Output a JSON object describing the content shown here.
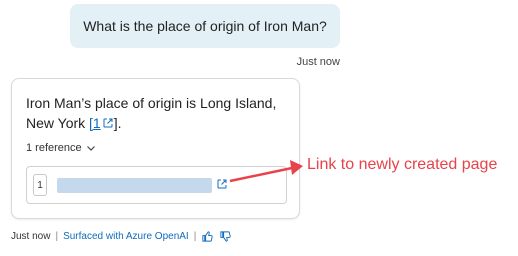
{
  "user_message": {
    "text": "What is the place of origin of Iron Man?",
    "timestamp": "Just now"
  },
  "bot_message": {
    "answer_before_link": "Iron Man’s place of origin is Long Island, New York ",
    "citation_label": "[1",
    "answer_after_link": "].",
    "references_label": "1 reference",
    "references": [
      {
        "number": "1",
        "title_redacted": true
      }
    ]
  },
  "footer": {
    "timestamp": "Just now",
    "separator": "|",
    "surfaced_label": "Surfaced with Azure OpenAI",
    "icons": [
      "thumbs-up-icon",
      "thumbs-down-icon"
    ]
  },
  "annotation": {
    "text": "Link to newly created page",
    "color": "#e8424a"
  },
  "colors": {
    "user_bubble": "#e3f1f6",
    "link": "#0f6cbd",
    "redaction": "#c5d9ed"
  }
}
